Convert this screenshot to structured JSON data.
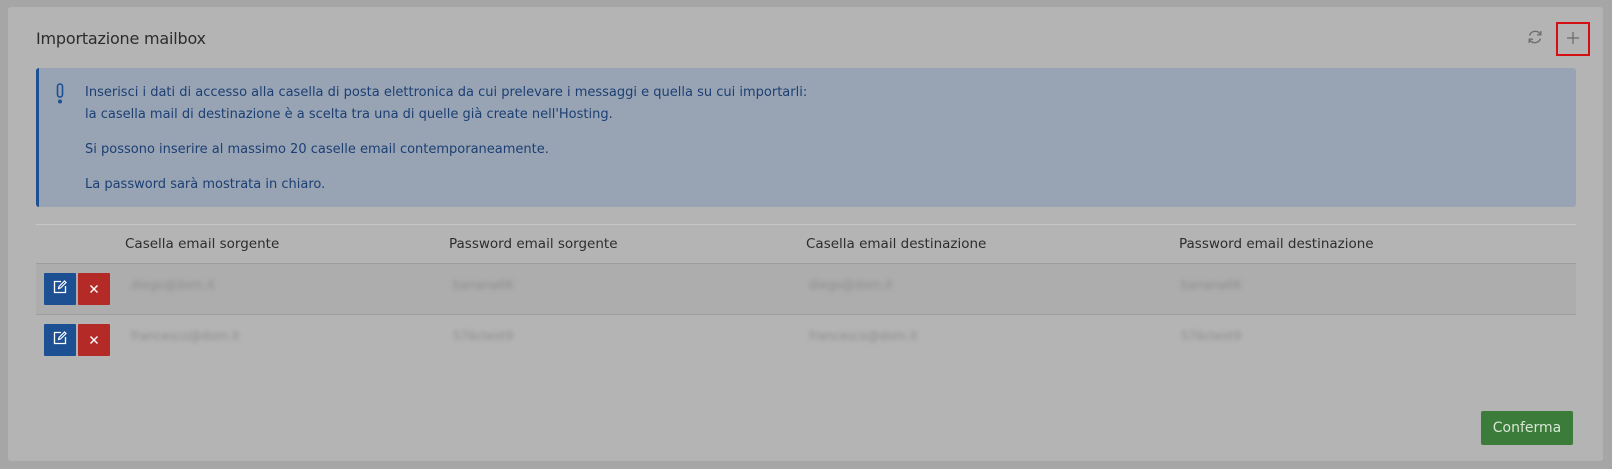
{
  "panel": {
    "title": "Importazione mailbox",
    "refresh_icon": "refresh-icon",
    "add_icon": "plus-icon"
  },
  "alert": {
    "icon": "exclamation-icon",
    "line1": "Inserisci i dati di accesso alla casella di posta elettronica da cui prelevare i messaggi e quella su cui importarli:",
    "line2": "la casella mail di destinazione è a scelta tra una di quelle già create nell'Hosting.",
    "line3": "Si possono inserire al massimo 20 caselle email contemporaneamente.",
    "line4": "La password sarà mostrata in chiaro."
  },
  "table": {
    "headers": [
      "Casella email sorgente",
      "Password email sorgente",
      "Casella email destinazione",
      "Password email destinazione"
    ],
    "rows": [
      {
        "source_email": "diego@dom.it",
        "source_password": "banana66",
        "dest_email": "diego@dom.it",
        "dest_password": "banana66"
      },
      {
        "source_email": "francesco@dom.it",
        "source_password": "576ctest9",
        "dest_email": "francesco@dom.it",
        "dest_password": "576ctest9"
      }
    ]
  },
  "actions": {
    "confirm_label": "Conferma"
  },
  "colors": {
    "alert_border": "#1c4f93",
    "edit_button": "#1d4f93",
    "delete_button": "#b32a27",
    "confirm_button": "#3c7c3a",
    "highlight": "#d40f14"
  }
}
